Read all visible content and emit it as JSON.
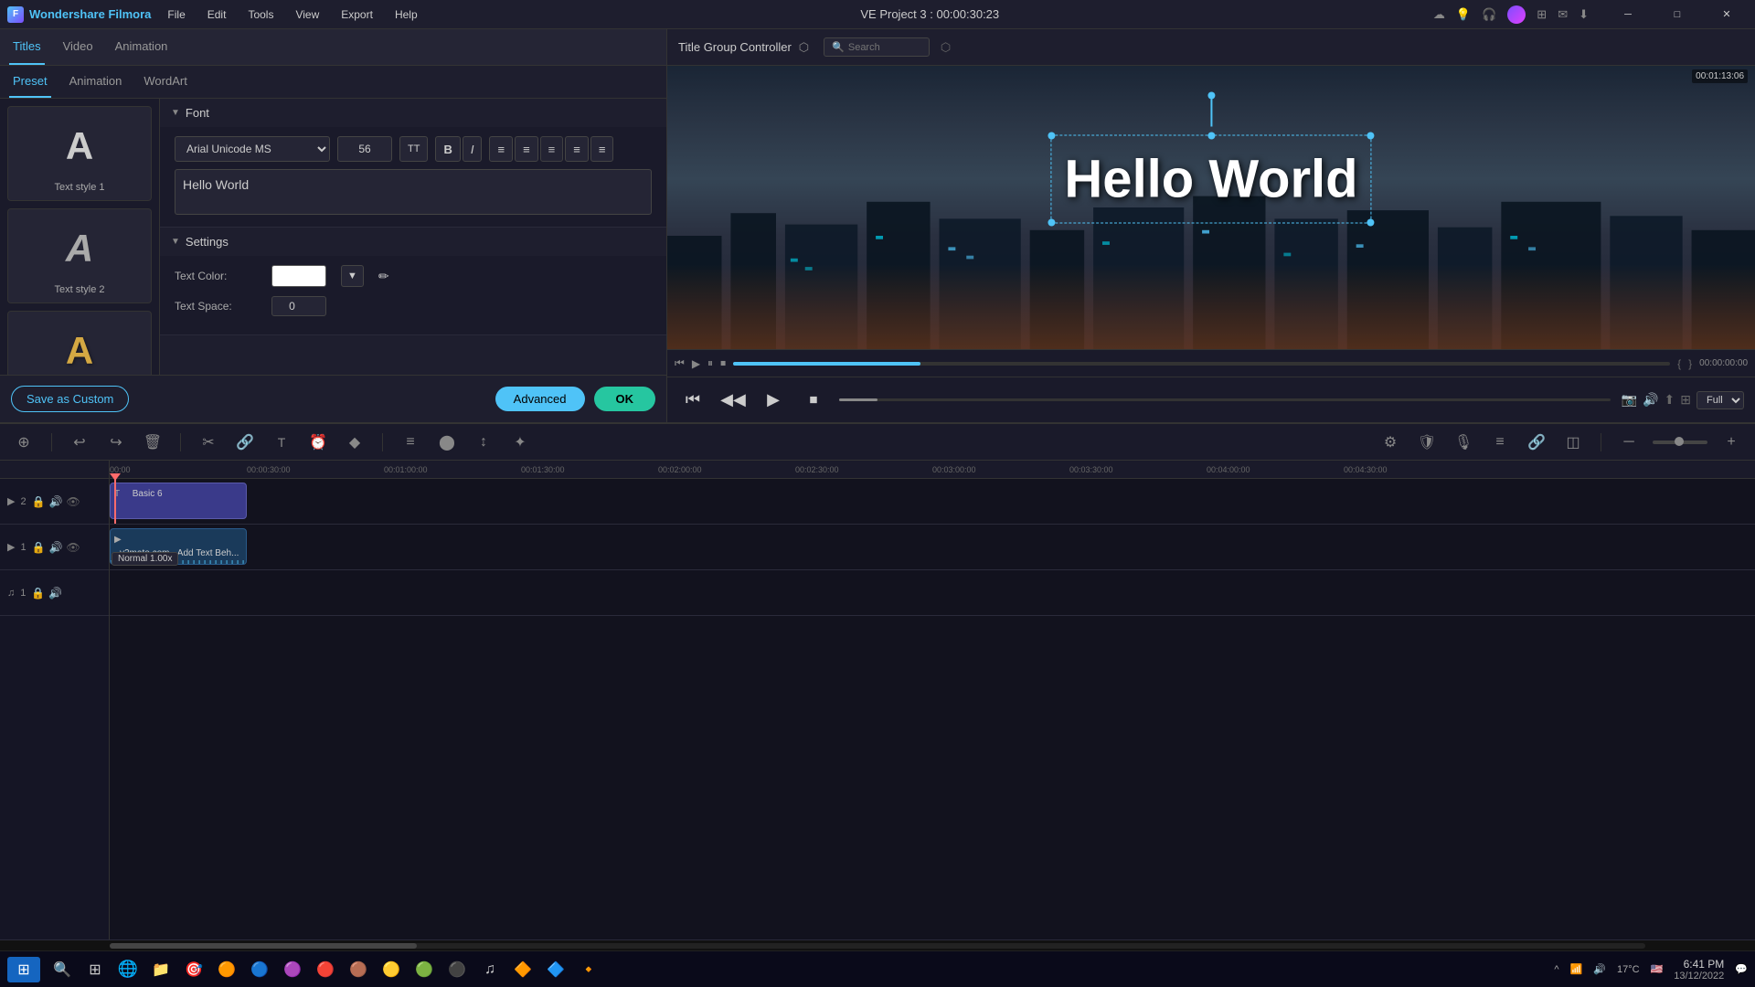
{
  "app": {
    "name": "Wondershare Filmora",
    "logo_letter": "F",
    "project_title": "VE Project 3 : 00:00:30:23",
    "version": "Wondershare Filmora"
  },
  "menu": {
    "items": [
      "File",
      "Edit",
      "Tools",
      "View",
      "Export",
      "Help"
    ]
  },
  "window_controls": {
    "minimize": "─",
    "maximize": "□",
    "close": "✕"
  },
  "left_panel": {
    "main_tabs": [
      "Titles",
      "Video",
      "Animation"
    ],
    "active_main_tab": "Titles",
    "sub_tabs": [
      "Preset",
      "Animation",
      "WordArt"
    ],
    "active_sub_tab": "Preset",
    "preset_items": [
      {
        "letter": "A",
        "style": "normal",
        "label": "Text style 1"
      },
      {
        "letter": "A",
        "style": "italic",
        "label": "Text style 2"
      },
      {
        "letter": "A",
        "style": "gold",
        "label": ""
      }
    ]
  },
  "font_section": {
    "title": "Font",
    "font_name": "Arial Unicode MS",
    "font_size": "56",
    "text_content": "Hello World",
    "buttons": {
      "bold": "B",
      "italic": "I",
      "align_left": "≡",
      "align_center": "≡",
      "align_right": "≡",
      "justify": "≡",
      "indent": "≡"
    }
  },
  "settings_section": {
    "title": "Settings",
    "text_color_label": "Text Color:",
    "text_space_label": "Text Space:",
    "text_space_value": "0"
  },
  "bottom_bar": {
    "save_custom": "Save as Custom",
    "advanced": "Advanced",
    "ok": "OK"
  },
  "title_group_controller": {
    "title": "Title Group Controller",
    "search_placeholder": "Search"
  },
  "preview": {
    "hello_world_text": "Hello World",
    "timestamp": "00:01:13:06",
    "quality": "Full",
    "playback_time": "00:00:00:00"
  },
  "playback_controls": {
    "rewind": "⏮",
    "play_back": "⏪",
    "play": "▶",
    "stop": "⏹",
    "forward": "⏩"
  },
  "timeline": {
    "toolbar_icons": [
      "⊕",
      "↩",
      "↪",
      "🗑",
      "✂",
      "🔗",
      "T",
      "⏰",
      "◆",
      "≡",
      "⬤",
      "↕",
      "✦"
    ],
    "right_icons": [
      "⚙",
      "🛡",
      "🎙",
      "≡",
      "🔗",
      "◫",
      "─",
      "+",
      ""
    ],
    "ruler_times": [
      "00:00",
      "00:00:30:00",
      "00:01:00:00",
      "00:01:30:00",
      "00:02:00:00",
      "00:02:30:00",
      "00:03:00:00",
      "00:03:30:00",
      "00:04:00:00",
      "00:04:30:00"
    ],
    "tracks": [
      {
        "id": "track-v2",
        "type": "video",
        "label": "2",
        "icons": [
          "👁",
          "🔒",
          "🔊",
          "👁"
        ],
        "clips": [
          {
            "label": "Basic 6",
            "type": "text",
            "left": 0,
            "width": 150
          }
        ]
      },
      {
        "id": "track-v1",
        "type": "video",
        "label": "1",
        "icons": [
          "👁",
          "🔒",
          "🔊",
          "👁"
        ],
        "clips": [
          {
            "label": "y2mate.com - Add Text Beh...",
            "type": "video",
            "left": 0,
            "width": 150
          }
        ]
      },
      {
        "id": "track-a1",
        "type": "audio",
        "label": "1",
        "icons": [
          "🎵",
          "🔒",
          "🔊"
        ],
        "clips": []
      }
    ],
    "speed_badge": "Normal 1.00x"
  },
  "taskbar": {
    "start_icon": "⊞",
    "app_icons": [
      "🔍",
      "⊞",
      "🌐",
      "📁",
      "📎",
      "⬇",
      "🎮",
      "🎵",
      "🎭",
      "🎯",
      "🌀",
      "🎸",
      "🟣",
      "♫",
      "🔵"
    ],
    "system_icons": [
      "^",
      "📶",
      "🔊",
      "🇺🇸"
    ],
    "temperature": "17°C",
    "time": "6:41 PM",
    "date": "13/12/2022",
    "notification_icon": "💬"
  }
}
